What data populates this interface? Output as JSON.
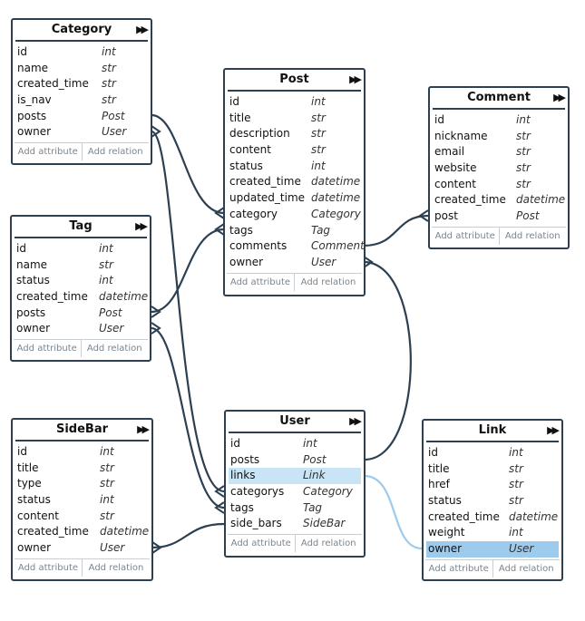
{
  "footer": {
    "add_attribute": "Add attribute",
    "add_relation": "Add relation"
  },
  "colors": {
    "line": "#2d4051",
    "highlight_line": "#9ccbed",
    "highlight_light": "#c9e4f5",
    "highlight_dark": "#9ccbed"
  },
  "entities": {
    "category": {
      "name": "Category",
      "fields": [
        {
          "name": "id",
          "type": "int"
        },
        {
          "name": "name",
          "type": "str"
        },
        {
          "name": "created_time",
          "type": "str"
        },
        {
          "name": "is_nav",
          "type": "str"
        },
        {
          "name": "posts",
          "type": "Post"
        },
        {
          "name": "owner",
          "type": "User"
        }
      ]
    },
    "tag": {
      "name": "Tag",
      "fields": [
        {
          "name": "id",
          "type": "int"
        },
        {
          "name": "name",
          "type": "str"
        },
        {
          "name": "status",
          "type": "int"
        },
        {
          "name": "created_time",
          "type": "datetime"
        },
        {
          "name": "posts",
          "type": "Post"
        },
        {
          "name": "owner",
          "type": "User"
        }
      ]
    },
    "sidebar": {
      "name": "SideBar",
      "fields": [
        {
          "name": "id",
          "type": "int"
        },
        {
          "name": "title",
          "type": "str"
        },
        {
          "name": "type",
          "type": "str"
        },
        {
          "name": "status",
          "type": "int"
        },
        {
          "name": "content",
          "type": "str"
        },
        {
          "name": "created_time",
          "type": "datetime"
        },
        {
          "name": "owner",
          "type": "User"
        }
      ]
    },
    "post": {
      "name": "Post",
      "fields": [
        {
          "name": "id",
          "type": "int"
        },
        {
          "name": "title",
          "type": "str"
        },
        {
          "name": "description",
          "type": "str"
        },
        {
          "name": "content",
          "type": "str"
        },
        {
          "name": "status",
          "type": "int"
        },
        {
          "name": "created_time",
          "type": "datetime"
        },
        {
          "name": "updated_time",
          "type": "datetime"
        },
        {
          "name": "category",
          "type": "Category"
        },
        {
          "name": "tags",
          "type": "Tag"
        },
        {
          "name": "comments",
          "type": "Comment"
        },
        {
          "name": "owner",
          "type": "User"
        }
      ]
    },
    "user": {
      "name": "User",
      "fields": [
        {
          "name": "id",
          "type": "int"
        },
        {
          "name": "posts",
          "type": "Post"
        },
        {
          "name": "links",
          "type": "Link"
        },
        {
          "name": "categorys",
          "type": "Category"
        },
        {
          "name": "tags",
          "type": "Tag"
        },
        {
          "name": "side_bars",
          "type": "SideBar"
        }
      ]
    },
    "comment": {
      "name": "Comment",
      "fields": [
        {
          "name": "id",
          "type": "int"
        },
        {
          "name": "nickname",
          "type": "str"
        },
        {
          "name": "email",
          "type": "str"
        },
        {
          "name": "website",
          "type": "str"
        },
        {
          "name": "content",
          "type": "str"
        },
        {
          "name": "created_time",
          "type": "datetime"
        },
        {
          "name": "post",
          "type": "Post"
        }
      ]
    },
    "link": {
      "name": "Link",
      "fields": [
        {
          "name": "id",
          "type": "int"
        },
        {
          "name": "title",
          "type": "str"
        },
        {
          "name": "href",
          "type": "str"
        },
        {
          "name": "status",
          "type": "str"
        },
        {
          "name": "created_time",
          "type": "datetime"
        },
        {
          "name": "weight",
          "type": "int"
        },
        {
          "name": "owner",
          "type": "User"
        }
      ]
    }
  }
}
